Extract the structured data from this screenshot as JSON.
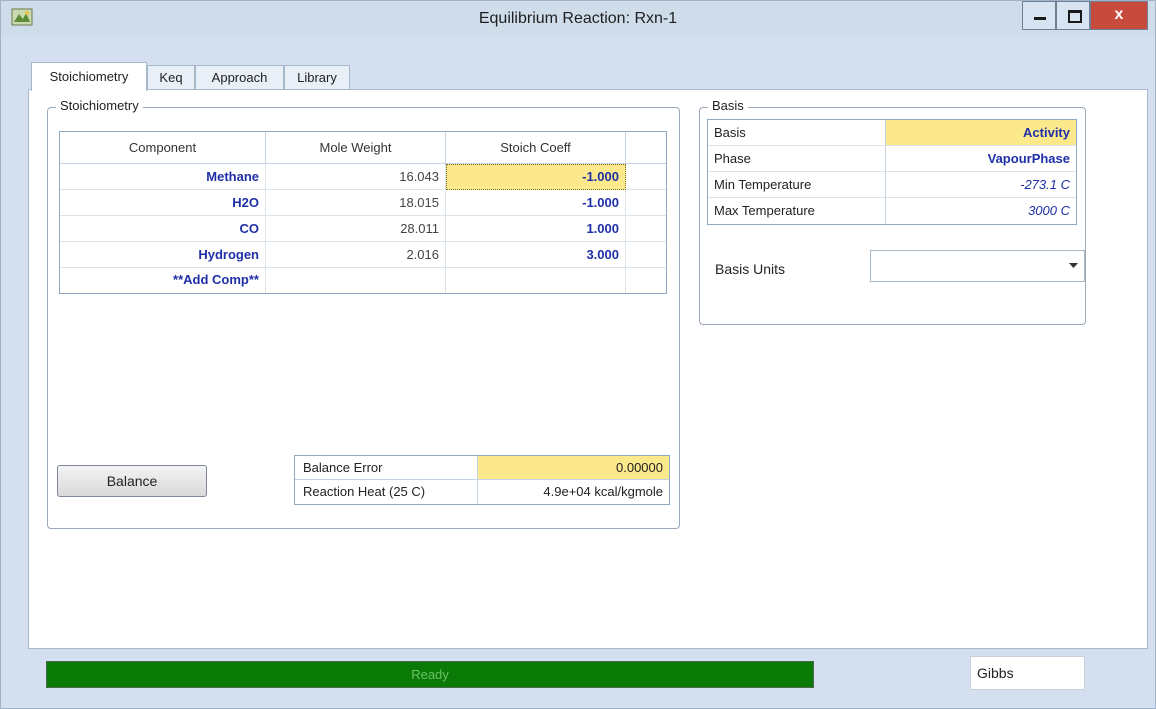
{
  "window": {
    "title": "Equilibrium Reaction: Rxn-1",
    "close_label": "x",
    "icon": "app-icon"
  },
  "tabs": [
    {
      "label": "Stoichiometry",
      "active": true
    },
    {
      "label": "Keq",
      "active": false
    },
    {
      "label": "Approach",
      "active": false
    },
    {
      "label": "Library",
      "active": false
    }
  ],
  "stoich_group": {
    "legend": "Stoichiometry",
    "headers": [
      "Component",
      "Mole Weight",
      "Stoich Coeff"
    ],
    "rows": [
      {
        "component": "Methane",
        "mole_weight": "16.043",
        "stoich": "-1.000"
      },
      {
        "component": "H2O",
        "mole_weight": "18.015",
        "stoich": "-1.000"
      },
      {
        "component": "CO",
        "mole_weight": "28.011",
        "stoich": "1.000"
      },
      {
        "component": "Hydrogen",
        "mole_weight": "2.016",
        "stoich": "3.000"
      },
      {
        "component": "**Add Comp**",
        "mole_weight": "",
        "stoich": ""
      }
    ],
    "balance_button": "Balance",
    "results": [
      {
        "label": "Balance Error",
        "value": "0.00000"
      },
      {
        "label": "Reaction Heat (25 C)",
        "value": "4.9e+04 kcal/kgmole"
      }
    ]
  },
  "basis_group": {
    "legend": "Basis",
    "rows": [
      {
        "label": "Basis",
        "value": "Activity"
      },
      {
        "label": "Phase",
        "value": "VapourPhase"
      },
      {
        "label": "Min Temperature",
        "value": "-273.1 C"
      },
      {
        "label": "Max Temperature",
        "value": "3000 C"
      }
    ],
    "units_label": "Basis Units",
    "units_value": ""
  },
  "status": {
    "text": "Ready",
    "method": "Gibbs"
  },
  "colors": {
    "highlight": "#fce98b",
    "blue_text": "#1f2fa8",
    "status_green": "#0a7a07"
  }
}
